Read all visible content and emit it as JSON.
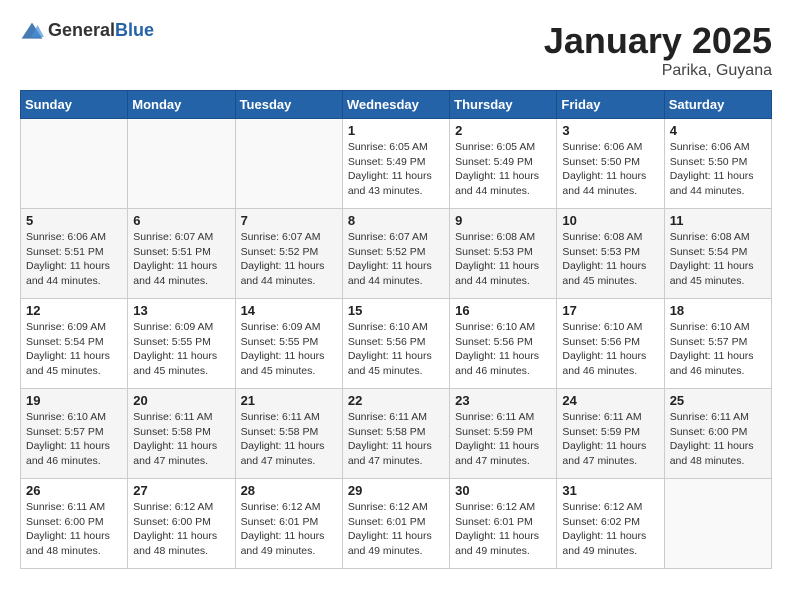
{
  "header": {
    "logo_general": "General",
    "logo_blue": "Blue",
    "month": "January 2025",
    "location": "Parika, Guyana"
  },
  "weekdays": [
    "Sunday",
    "Monday",
    "Tuesday",
    "Wednesday",
    "Thursday",
    "Friday",
    "Saturday"
  ],
  "weeks": [
    [
      {
        "day": "",
        "info": ""
      },
      {
        "day": "",
        "info": ""
      },
      {
        "day": "",
        "info": ""
      },
      {
        "day": "1",
        "info": "Sunrise: 6:05 AM\nSunset: 5:49 PM\nDaylight: 11 hours\nand 43 minutes."
      },
      {
        "day": "2",
        "info": "Sunrise: 6:05 AM\nSunset: 5:49 PM\nDaylight: 11 hours\nand 44 minutes."
      },
      {
        "day": "3",
        "info": "Sunrise: 6:06 AM\nSunset: 5:50 PM\nDaylight: 11 hours\nand 44 minutes."
      },
      {
        "day": "4",
        "info": "Sunrise: 6:06 AM\nSunset: 5:50 PM\nDaylight: 11 hours\nand 44 minutes."
      }
    ],
    [
      {
        "day": "5",
        "info": "Sunrise: 6:06 AM\nSunset: 5:51 PM\nDaylight: 11 hours\nand 44 minutes."
      },
      {
        "day": "6",
        "info": "Sunrise: 6:07 AM\nSunset: 5:51 PM\nDaylight: 11 hours\nand 44 minutes."
      },
      {
        "day": "7",
        "info": "Sunrise: 6:07 AM\nSunset: 5:52 PM\nDaylight: 11 hours\nand 44 minutes."
      },
      {
        "day": "8",
        "info": "Sunrise: 6:07 AM\nSunset: 5:52 PM\nDaylight: 11 hours\nand 44 minutes."
      },
      {
        "day": "9",
        "info": "Sunrise: 6:08 AM\nSunset: 5:53 PM\nDaylight: 11 hours\nand 44 minutes."
      },
      {
        "day": "10",
        "info": "Sunrise: 6:08 AM\nSunset: 5:53 PM\nDaylight: 11 hours\nand 45 minutes."
      },
      {
        "day": "11",
        "info": "Sunrise: 6:08 AM\nSunset: 5:54 PM\nDaylight: 11 hours\nand 45 minutes."
      }
    ],
    [
      {
        "day": "12",
        "info": "Sunrise: 6:09 AM\nSunset: 5:54 PM\nDaylight: 11 hours\nand 45 minutes."
      },
      {
        "day": "13",
        "info": "Sunrise: 6:09 AM\nSunset: 5:55 PM\nDaylight: 11 hours\nand 45 minutes."
      },
      {
        "day": "14",
        "info": "Sunrise: 6:09 AM\nSunset: 5:55 PM\nDaylight: 11 hours\nand 45 minutes."
      },
      {
        "day": "15",
        "info": "Sunrise: 6:10 AM\nSunset: 5:56 PM\nDaylight: 11 hours\nand 45 minutes."
      },
      {
        "day": "16",
        "info": "Sunrise: 6:10 AM\nSunset: 5:56 PM\nDaylight: 11 hours\nand 46 minutes."
      },
      {
        "day": "17",
        "info": "Sunrise: 6:10 AM\nSunset: 5:56 PM\nDaylight: 11 hours\nand 46 minutes."
      },
      {
        "day": "18",
        "info": "Sunrise: 6:10 AM\nSunset: 5:57 PM\nDaylight: 11 hours\nand 46 minutes."
      }
    ],
    [
      {
        "day": "19",
        "info": "Sunrise: 6:10 AM\nSunset: 5:57 PM\nDaylight: 11 hours\nand 46 minutes."
      },
      {
        "day": "20",
        "info": "Sunrise: 6:11 AM\nSunset: 5:58 PM\nDaylight: 11 hours\nand 47 minutes."
      },
      {
        "day": "21",
        "info": "Sunrise: 6:11 AM\nSunset: 5:58 PM\nDaylight: 11 hours\nand 47 minutes."
      },
      {
        "day": "22",
        "info": "Sunrise: 6:11 AM\nSunset: 5:58 PM\nDaylight: 11 hours\nand 47 minutes."
      },
      {
        "day": "23",
        "info": "Sunrise: 6:11 AM\nSunset: 5:59 PM\nDaylight: 11 hours\nand 47 minutes."
      },
      {
        "day": "24",
        "info": "Sunrise: 6:11 AM\nSunset: 5:59 PM\nDaylight: 11 hours\nand 47 minutes."
      },
      {
        "day": "25",
        "info": "Sunrise: 6:11 AM\nSunset: 6:00 PM\nDaylight: 11 hours\nand 48 minutes."
      }
    ],
    [
      {
        "day": "26",
        "info": "Sunrise: 6:11 AM\nSunset: 6:00 PM\nDaylight: 11 hours\nand 48 minutes."
      },
      {
        "day": "27",
        "info": "Sunrise: 6:12 AM\nSunset: 6:00 PM\nDaylight: 11 hours\nand 48 minutes."
      },
      {
        "day": "28",
        "info": "Sunrise: 6:12 AM\nSunset: 6:01 PM\nDaylight: 11 hours\nand 49 minutes."
      },
      {
        "day": "29",
        "info": "Sunrise: 6:12 AM\nSunset: 6:01 PM\nDaylight: 11 hours\nand 49 minutes."
      },
      {
        "day": "30",
        "info": "Sunrise: 6:12 AM\nSunset: 6:01 PM\nDaylight: 11 hours\nand 49 minutes."
      },
      {
        "day": "31",
        "info": "Sunrise: 6:12 AM\nSunset: 6:02 PM\nDaylight: 11 hours\nand 49 minutes."
      },
      {
        "day": "",
        "info": ""
      }
    ]
  ]
}
